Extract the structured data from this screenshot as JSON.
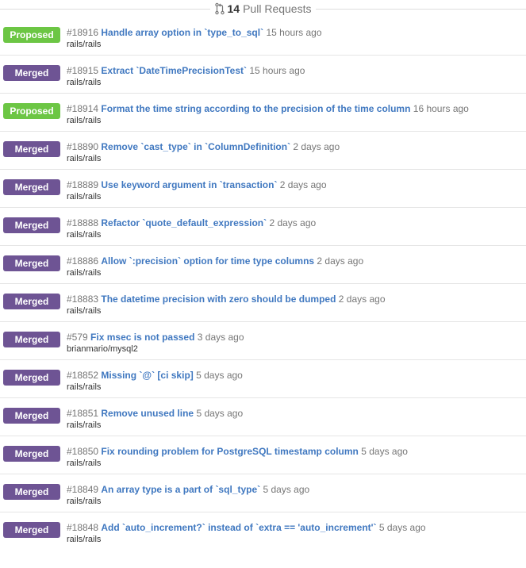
{
  "header": {
    "icon": "git-pull-request-icon",
    "count": "14",
    "label": "Pull Requests"
  },
  "colors": {
    "merged": "#6e5494",
    "proposed": "#6cc644",
    "link": "#4078c0",
    "muted": "#767676"
  },
  "pull_requests": [
    {
      "status": "Proposed",
      "status_key": "proposed",
      "number": "#18916",
      "title": "Handle array option in `type_to_sql`",
      "age": "15 hours ago",
      "repo": "rails/rails"
    },
    {
      "status": "Merged",
      "status_key": "merged",
      "number": "#18915",
      "title": "Extract `DateTimePrecisionTest`",
      "age": "15 hours ago",
      "repo": "rails/rails"
    },
    {
      "status": "Proposed",
      "status_key": "proposed",
      "number": "#18914",
      "title": "Format the time string according to the precision of the time column",
      "age": "16 hours ago",
      "repo": "rails/rails"
    },
    {
      "status": "Merged",
      "status_key": "merged",
      "number": "#18890",
      "title": "Remove `cast_type` in `ColumnDefinition`",
      "age": "2 days ago",
      "repo": "rails/rails"
    },
    {
      "status": "Merged",
      "status_key": "merged",
      "number": "#18889",
      "title": "Use keyword argument in `transaction`",
      "age": "2 days ago",
      "repo": "rails/rails"
    },
    {
      "status": "Merged",
      "status_key": "merged",
      "number": "#18888",
      "title": "Refactor `quote_default_expression`",
      "age": "2 days ago",
      "repo": "rails/rails"
    },
    {
      "status": "Merged",
      "status_key": "merged",
      "number": "#18886",
      "title": "Allow `:precision` option for time type columns",
      "age": "2 days ago",
      "repo": "rails/rails"
    },
    {
      "status": "Merged",
      "status_key": "merged",
      "number": "#18883",
      "title": "The datetime precision with zero should be dumped",
      "age": "2 days ago",
      "repo": "rails/rails"
    },
    {
      "status": "Merged",
      "status_key": "merged",
      "number": "#579",
      "title": "Fix msec is not passed",
      "age": "3 days ago",
      "repo": "brianmario/mysql2"
    },
    {
      "status": "Merged",
      "status_key": "merged",
      "number": "#18852",
      "title": "Missing `@` [ci skip]",
      "age": "5 days ago",
      "repo": "rails/rails"
    },
    {
      "status": "Merged",
      "status_key": "merged",
      "number": "#18851",
      "title": "Remove unused line",
      "age": "5 days ago",
      "repo": "rails/rails"
    },
    {
      "status": "Merged",
      "status_key": "merged",
      "number": "#18850",
      "title": "Fix rounding problem for PostgreSQL timestamp column",
      "age": "5 days ago",
      "repo": "rails/rails"
    },
    {
      "status": "Merged",
      "status_key": "merged",
      "number": "#18849",
      "title": "An array type is a part of `sql_type`",
      "age": "5 days ago",
      "repo": "rails/rails"
    },
    {
      "status": "Merged",
      "status_key": "merged",
      "number": "#18848",
      "title": "Add `auto_increment?` instead of `extra == 'auto_increment'`",
      "age": "5 days ago",
      "repo": "rails/rails"
    }
  ]
}
